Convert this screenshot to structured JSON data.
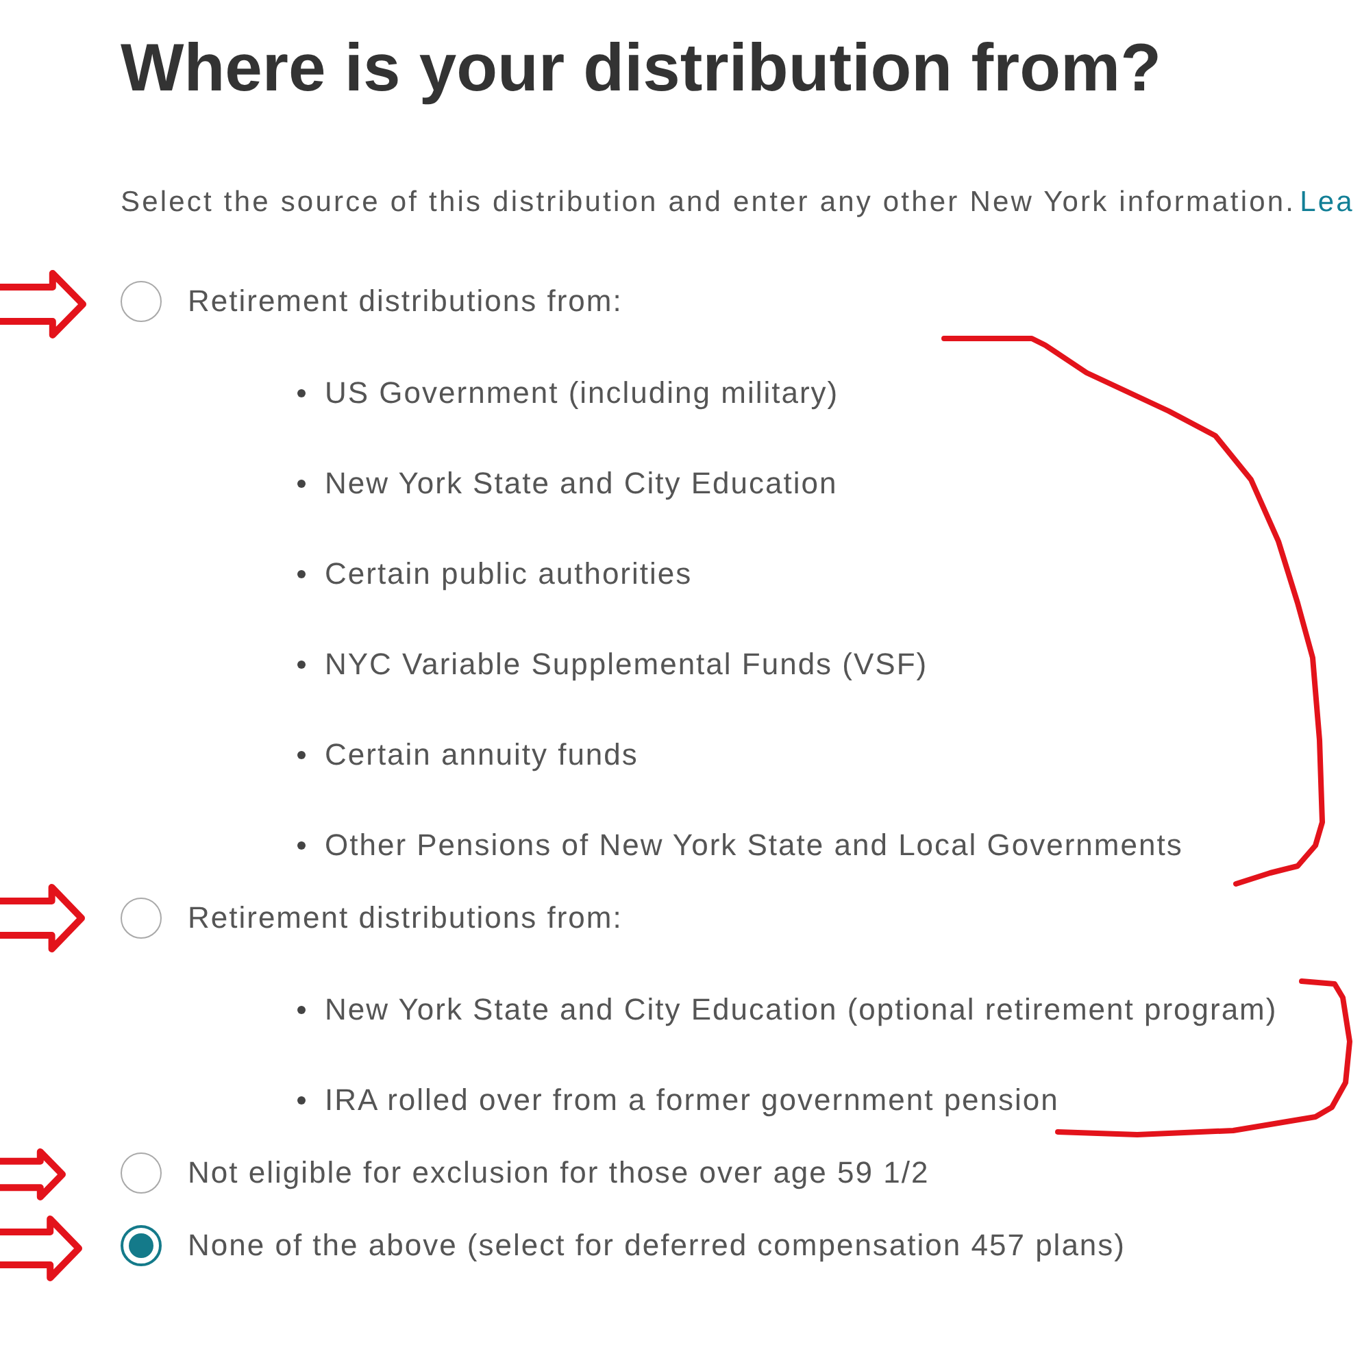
{
  "heading": "Where is your distribution from?",
  "instructions": {
    "text": "Select the source of this distribution and enter any other New York information.",
    "link": "Lea"
  },
  "options": [
    {
      "label": "Retirement distributions from:",
      "selected": false,
      "bullets": [
        "US Government (including military)",
        "New York State and City Education",
        "Certain public authorities",
        "NYC Variable Supplemental Funds (VSF)",
        "Certain annuity funds",
        "Other Pensions of New York State and Local Governments"
      ]
    },
    {
      "label": "Retirement distributions from:",
      "selected": false,
      "bullets": [
        "New York State and City Education (optional retirement program)",
        "IRA rolled over from a former government pension"
      ]
    },
    {
      "label": "Not eligible for exclusion for those over age 59 1/2",
      "selected": false
    },
    {
      "label": "None of the above (select for deferred compensation 457 plans)",
      "selected": true
    }
  ]
}
